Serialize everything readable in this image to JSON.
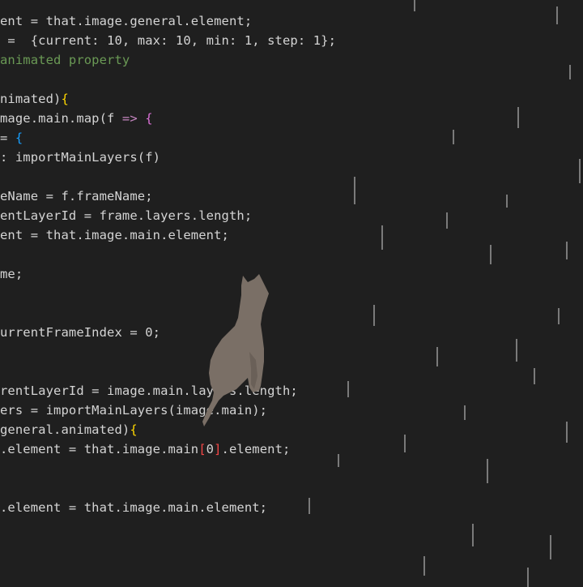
{
  "code": {
    "lines": [
      {
        "tokens": [
          {
            "t": "ent = that.image.general.element;",
            "c": "#d4d4d4"
          }
        ]
      },
      {
        "tokens": [
          {
            "t": " =  {current: 10, max: 10, min: 1, step: 1};",
            "c": "#d4d4d4"
          }
        ]
      },
      {
        "tokens": [
          {
            "t": "animated property",
            "c": "#6a9955"
          }
        ]
      },
      {
        "tokens": [
          {
            "t": "",
            "c": "#d4d4d4"
          }
        ]
      },
      {
        "tokens": [
          {
            "t": "nimated)",
            "c": "#d4d4d4"
          },
          {
            "t": "{",
            "c": "#ffd700"
          }
        ]
      },
      {
        "tokens": [
          {
            "t": "mage.main.map(f ",
            "c": "#d4d4d4"
          },
          {
            "t": "=>",
            "c": "#c586c0"
          },
          {
            "t": " ",
            "c": "#d4d4d4"
          },
          {
            "t": "{",
            "c": "#da70d6"
          }
        ]
      },
      {
        "tokens": [
          {
            "t": "= ",
            "c": "#d4d4d4"
          },
          {
            "t": "{",
            "c": "#179fff"
          }
        ]
      },
      {
        "tokens": [
          {
            "t": ": importMainLayers(f)",
            "c": "#d4d4d4"
          }
        ]
      },
      {
        "tokens": [
          {
            "t": "",
            "c": "#d4d4d4"
          }
        ]
      },
      {
        "tokens": [
          {
            "t": "eName = f.frameName;",
            "c": "#d4d4d4"
          }
        ]
      },
      {
        "tokens": [
          {
            "t": "entLayerId = frame.layers.length;",
            "c": "#d4d4d4"
          }
        ]
      },
      {
        "tokens": [
          {
            "t": "ent = that.image.main.element;",
            "c": "#d4d4d4"
          }
        ]
      },
      {
        "tokens": [
          {
            "t": "",
            "c": "#d4d4d4"
          }
        ]
      },
      {
        "tokens": [
          {
            "t": "me;",
            "c": "#d4d4d4"
          }
        ]
      },
      {
        "tokens": [
          {
            "t": "",
            "c": "#d4d4d4"
          }
        ]
      },
      {
        "tokens": [
          {
            "t": "",
            "c": "#d4d4d4"
          }
        ]
      },
      {
        "tokens": [
          {
            "t": "urrentFrameIndex = 0;",
            "c": "#d4d4d4"
          }
        ]
      },
      {
        "tokens": [
          {
            "t": "",
            "c": "#d4d4d4"
          }
        ]
      },
      {
        "tokens": [
          {
            "t": "",
            "c": "#d4d4d4"
          }
        ]
      },
      {
        "tokens": [
          {
            "t": "rentLayerId = image.main.layers.length;",
            "c": "#d4d4d4"
          }
        ]
      },
      {
        "tokens": [
          {
            "t": "ers = importMainLayers(image.main);",
            "c": "#d4d4d4"
          }
        ]
      },
      {
        "tokens": [
          {
            "t": "general.animated)",
            "c": "#d4d4d4"
          },
          {
            "t": "{",
            "c": "#ffd700"
          }
        ]
      },
      {
        "tokens": [
          {
            "t": ".element = that.image.main",
            "c": "#d4d4d4"
          },
          {
            "t": "[",
            "c": "#f44747"
          },
          {
            "t": "0",
            "c": "#d4d4d4"
          },
          {
            "t": "]",
            "c": "#f44747"
          },
          {
            "t": ".element;",
            "c": "#d4d4d4"
          }
        ]
      },
      {
        "tokens": [
          {
            "t": "",
            "c": "#d4d4d4"
          }
        ]
      },
      {
        "tokens": [
          {
            "t": "",
            "c": "#d4d4d4"
          }
        ]
      },
      {
        "tokens": [
          {
            "t": ".element = that.image.main.element;",
            "c": "#d4d4d4"
          }
        ]
      }
    ]
  },
  "scene": {
    "background_color": "#1f1f1f",
    "cat_color": "#7a6f66",
    "rain_color": "#9a9a9a"
  }
}
